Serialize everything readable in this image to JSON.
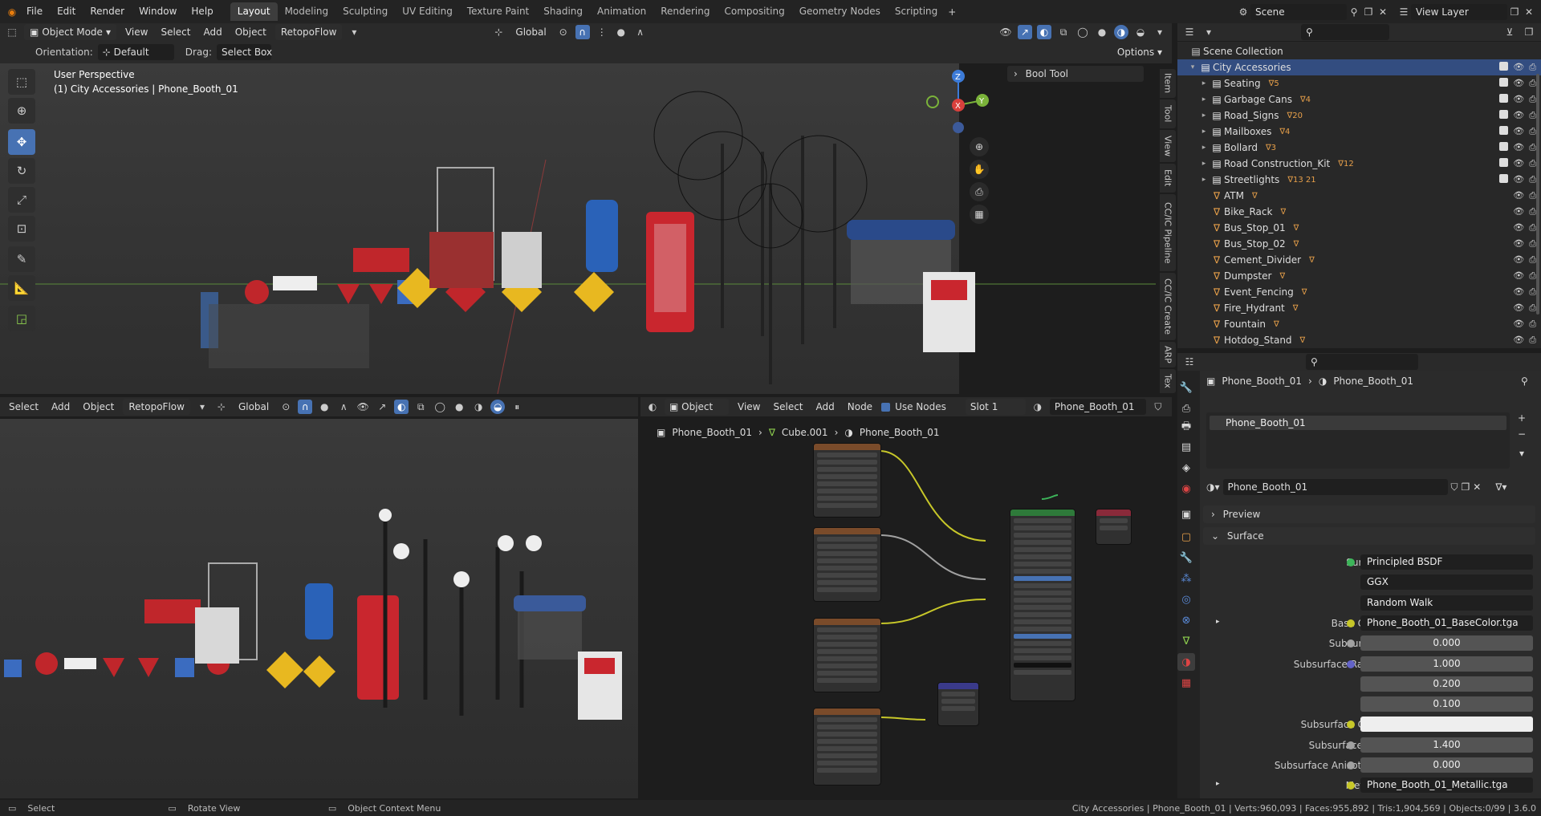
{
  "menubar": {
    "items": [
      "File",
      "Edit",
      "Render",
      "Window",
      "Help"
    ],
    "workspaces": [
      "Layout",
      "Modeling",
      "Sculpting",
      "UV Editing",
      "Texture Paint",
      "Shading",
      "Animation",
      "Rendering",
      "Compositing",
      "Geometry Nodes",
      "Scripting"
    ],
    "active_workspace": "Layout",
    "scene": "Scene",
    "view_layer": "View Layer"
  },
  "viewport_header": {
    "mode": "Object Mode",
    "menus": [
      "View",
      "Select",
      "Add",
      "Object"
    ],
    "addon": "RetopoFlow",
    "transform": "Global",
    "orientation_label": "Orientation:",
    "orientation_value": "Default",
    "drag_label": "Drag:",
    "drag_value": "Select Box",
    "options": "Options"
  },
  "viewport": {
    "perspective": "User Perspective",
    "selection": "(1) City Accessories | Phone_Booth_01",
    "bool_tool": "Bool Tool",
    "side_tabs": [
      "Item",
      "Tool",
      "View",
      "Edit",
      "CC/IC Pipeline",
      "CC/IC Create",
      "ARP",
      "Tex"
    ],
    "gizmo": {
      "z": "Z",
      "x": "X",
      "y": "Y"
    }
  },
  "viewport2_header": {
    "menus": [
      "Select",
      "Add",
      "Object"
    ],
    "addon": "RetopoFlow",
    "transform": "Global"
  },
  "node_editor": {
    "type": "Object",
    "menus": [
      "View",
      "Select",
      "Add",
      "Node"
    ],
    "use_nodes": "Use Nodes",
    "slot": "Slot 1",
    "material": "Phone_Booth_01",
    "breadcrumb": [
      "Phone_Booth_01",
      "Cube.001",
      "Phone_Booth_01"
    ]
  },
  "outliner": {
    "root": "Scene Collection",
    "collection": "City Accessories",
    "items": [
      {
        "name": "Seating",
        "badge": "5"
      },
      {
        "name": "Garbage Cans",
        "badge": "4"
      },
      {
        "name": "Road_Signs",
        "badge": "20"
      },
      {
        "name": "Mailboxes",
        "badge": "4"
      },
      {
        "name": "Bollard",
        "badge": "3"
      },
      {
        "name": "Road Construction_Kit",
        "badge": "12"
      },
      {
        "name": "Streetlights",
        "badge": "13 21"
      },
      {
        "name": "ATM",
        "badge": ""
      },
      {
        "name": "Bike_Rack",
        "badge": ""
      },
      {
        "name": "Bus_Stop_01",
        "badge": ""
      },
      {
        "name": "Bus_Stop_02",
        "badge": ""
      },
      {
        "name": "Cement_Divider",
        "badge": ""
      },
      {
        "name": "Dumpster",
        "badge": ""
      },
      {
        "name": "Event_Fencing",
        "badge": ""
      },
      {
        "name": "Fire_Hydrant",
        "badge": ""
      },
      {
        "name": "Fountain",
        "badge": ""
      },
      {
        "name": "Hotdog_Stand",
        "badge": ""
      }
    ]
  },
  "properties": {
    "breadcrumb_object": "Phone_Booth_01",
    "breadcrumb_material": "Phone_Booth_01",
    "slot_item": "Phone_Booth_01",
    "material_name": "Phone_Booth_01",
    "preview": "Preview",
    "surface_section": "Surface",
    "rows": [
      {
        "label": "Surface",
        "value": "Principled BSDF",
        "dot": "#3db55a",
        "kind": "dark"
      },
      {
        "label": "",
        "value": "GGX",
        "dot": "",
        "kind": "dark"
      },
      {
        "label": "",
        "value": "Random Walk",
        "dot": "",
        "kind": "dark"
      },
      {
        "label": "Base Color",
        "value": "Phone_Booth_01_BaseColor.tga",
        "dot": "#c7c729",
        "kind": "dark"
      },
      {
        "label": "Subsurface",
        "value": "0.000",
        "dot": "#a1a1a1",
        "kind": "num"
      },
      {
        "label": "Subsurface Radius",
        "value": "1.000",
        "dot": "#6363c7",
        "kind": "num"
      },
      {
        "label": "",
        "value": "0.200",
        "dot": "",
        "kind": "num"
      },
      {
        "label": "",
        "value": "0.100",
        "dot": "",
        "kind": "num"
      },
      {
        "label": "Subsurface Color",
        "value": "",
        "dot": "#c7c729",
        "kind": "white"
      },
      {
        "label": "Subsurface IOR",
        "value": "1.400",
        "dot": "#a1a1a1",
        "kind": "num"
      },
      {
        "label": "Subsurface Anisotropy",
        "value": "0.000",
        "dot": "#a1a1a1",
        "kind": "num"
      },
      {
        "label": "Metallic",
        "value": "Phone_Booth_01_Metallic.tga",
        "dot": "#c7c729",
        "kind": "dark"
      }
    ]
  },
  "status": {
    "select": "Select",
    "rotate": "Rotate View",
    "context": "Object Context Menu",
    "stats": "City Accessories | Phone_Booth_01 | Verts:960,093 | Faces:955,892 | Tris:1,904,569 | Objects:0/99 | 3.6.0"
  },
  "colors": {
    "accent": "#4772b3",
    "selected_row": "#334d80",
    "socket_yellow": "#c7c729"
  }
}
